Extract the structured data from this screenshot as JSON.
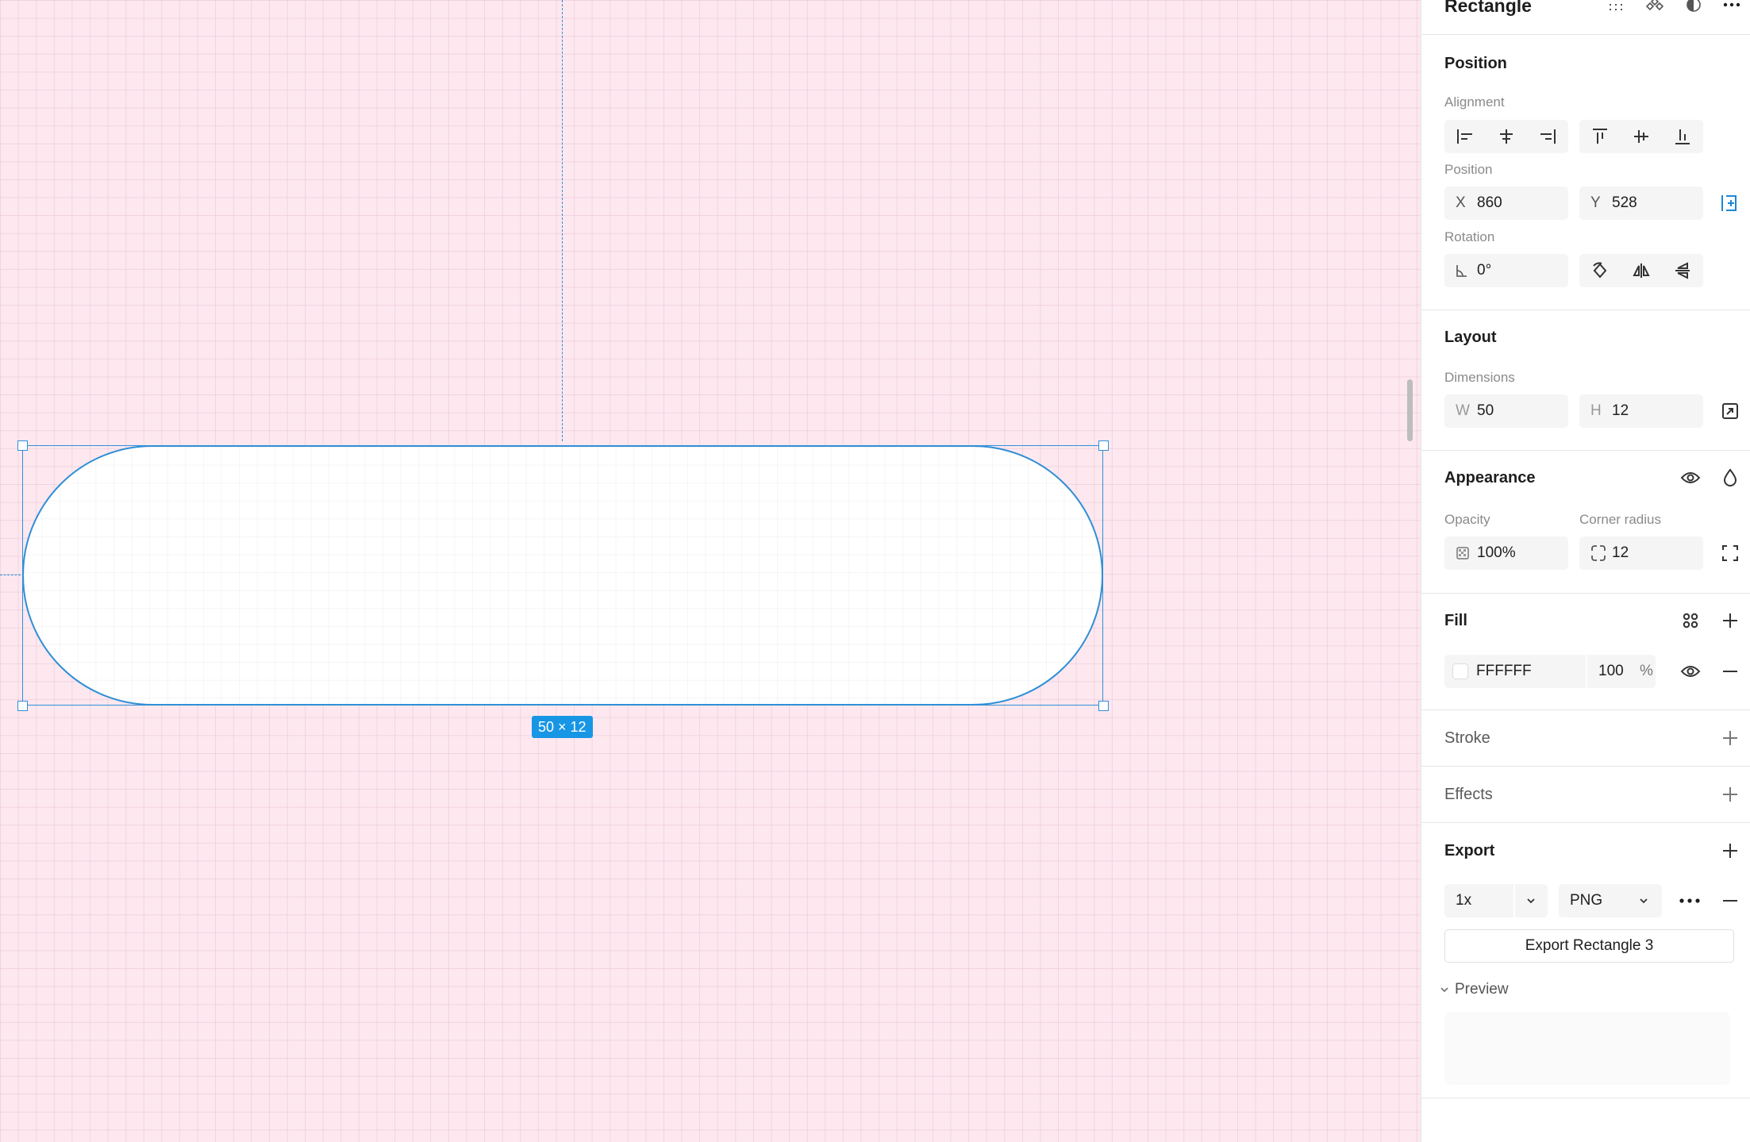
{
  "canvas": {
    "selection_size": "50 × 12",
    "background_color": "#fde8f0",
    "accent_color": "#2f8fd6"
  },
  "panel": {
    "header": {
      "title": "Rectangle"
    },
    "position": {
      "title": "Position",
      "alignment_label": "Alignment",
      "position_label": "Position",
      "x_prefix": "X",
      "x_value": "860",
      "y_prefix": "Y",
      "y_value": "528",
      "rotation_label": "Rotation",
      "rotation_value": "0°"
    },
    "layout": {
      "title": "Layout",
      "dimensions_label": "Dimensions",
      "w_prefix": "W",
      "w_value": "50",
      "h_prefix": "H",
      "h_value": "12"
    },
    "appearance": {
      "title": "Appearance",
      "opacity_label": "Opacity",
      "opacity_value": "100%",
      "corner_label": "Corner radius",
      "corner_value": "12"
    },
    "fill": {
      "title": "Fill",
      "hex": "FFFFFF",
      "opacity": "100",
      "percent": "%",
      "swatch_color": "#FFFFFF"
    },
    "stroke": {
      "title": "Stroke"
    },
    "effects": {
      "title": "Effects"
    },
    "export": {
      "title": "Export",
      "scale": "1x",
      "format": "PNG",
      "button_label": "Export Rectangle 3",
      "preview_label": "Preview"
    }
  }
}
